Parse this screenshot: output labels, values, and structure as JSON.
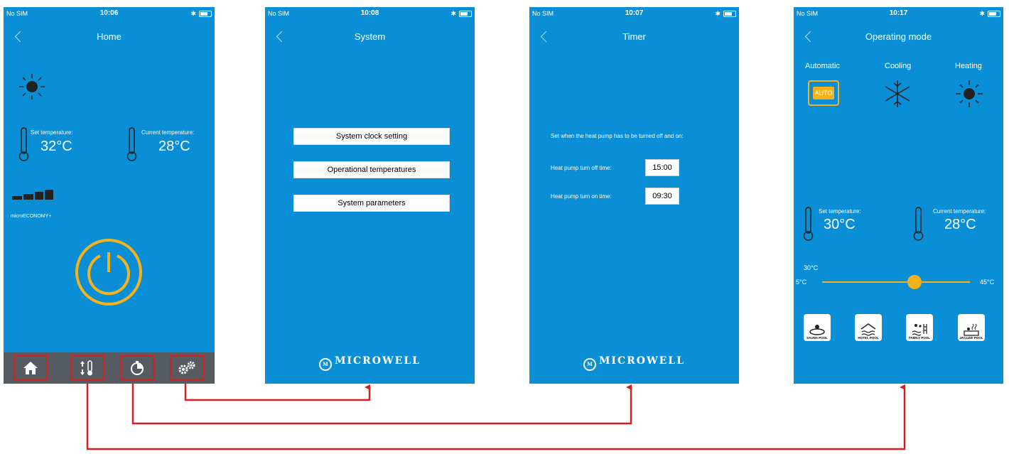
{
  "screens": {
    "home": {
      "status": {
        "carrier": "No SIM",
        "time": "10:06"
      },
      "title": "Home",
      "set_label": "Set temperature:",
      "set_value": "32°C",
      "current_label": "Current temperature:",
      "current_value": "28°C",
      "mode_label": "microECONOMY+",
      "tabs": [
        "home-icon",
        "thermometer-arrows-icon",
        "timer-icon",
        "gears-icon"
      ]
    },
    "system": {
      "status": {
        "carrier": "No SIM",
        "time": "10:08"
      },
      "title": "System",
      "items": [
        "System clock setting",
        "Operational temperatures",
        "System parameters"
      ],
      "brand": "MICROWELL"
    },
    "timer": {
      "status": {
        "carrier": "No SIM",
        "time": "10:07"
      },
      "title": "Timer",
      "instruction": "Set when the heat pump has to be turned off and on:",
      "off_label": "Heat pump turn off time:",
      "off_value": "15:00",
      "on_label": "Heat pump turn on time:",
      "on_value": "09:30",
      "brand": "MICROWELL"
    },
    "operating": {
      "status": {
        "carrier": "No SIM",
        "time": "10:17"
      },
      "title": "Operating mode",
      "modes": [
        "Automatic",
        "Cooling",
        "Heating"
      ],
      "auto_badge": "AUTO",
      "set_label": "Set temperature:",
      "set_value": "30°C",
      "current_label": "Current temperature:",
      "current_value": "28°C",
      "slider_value": "30°C",
      "slider_min": "5°C",
      "slider_max": "45°C",
      "slider_fraction": 0.625,
      "pools": [
        "SAUNA POOL",
        "HOTEL POOL",
        "FAMILY POOL",
        "JACUZZI POOL"
      ]
    }
  },
  "colors": {
    "screen_bg": "#0a8fd6",
    "accent": "#f5b21b",
    "arrow": "#d61f1f",
    "tabbar": "#555b61"
  }
}
